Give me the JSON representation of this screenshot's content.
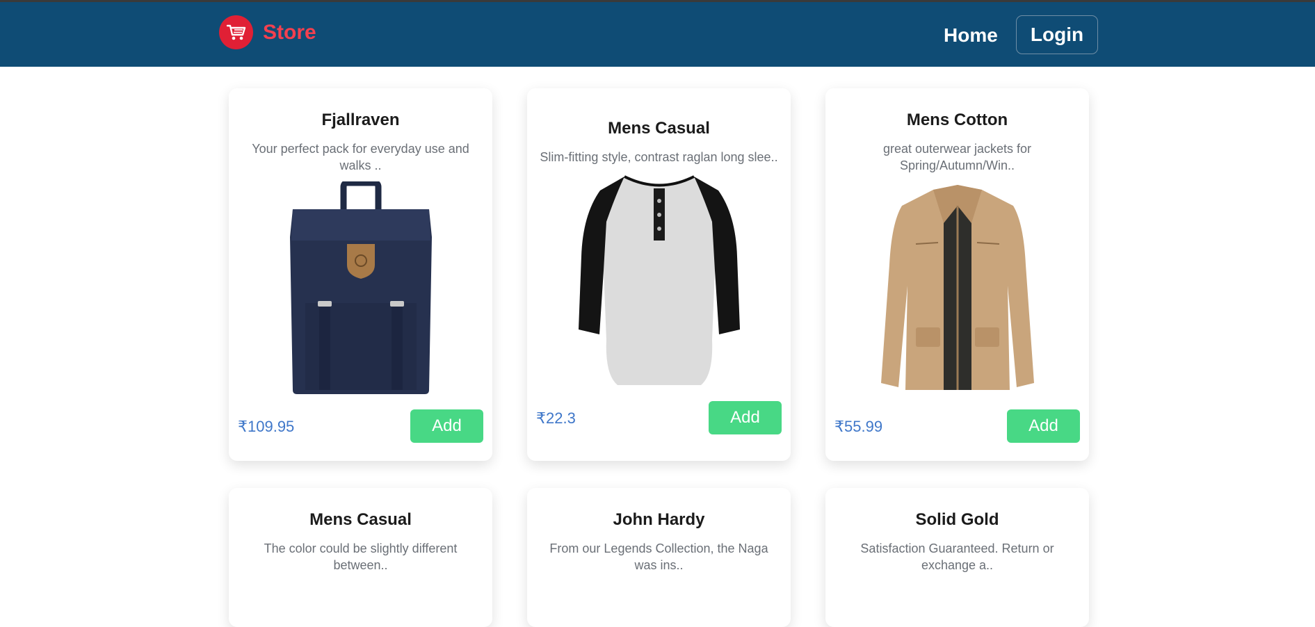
{
  "header": {
    "brand": "Store",
    "nav_home": "Home",
    "nav_login": "Login"
  },
  "colors": {
    "navbar": "#0f4c75",
    "brand": "#f4404f",
    "price": "#3f77c9",
    "add_button": "#48d885"
  },
  "products": [
    {
      "title": "Fjallraven",
      "description": "Your perfect pack for everyday use and walks ..",
      "price": "₹109.95",
      "add_label": "Add",
      "image_icon": "backpack-icon"
    },
    {
      "title": "Mens Casual",
      "description": "Slim-fitting style, contrast raglan long slee..",
      "price": "₹22.3",
      "add_label": "Add",
      "image_icon": "tshirt-icon"
    },
    {
      "title": "Mens Cotton",
      "description": "great outerwear jackets for Spring/Autumn/Win..",
      "price": "₹55.99",
      "add_label": "Add",
      "image_icon": "jacket-icon"
    },
    {
      "title": "Mens Casual",
      "description": "The color could be slightly different between..",
      "image_icon": ""
    },
    {
      "title": "John Hardy",
      "description": "From our Legends Collection, the Naga was ins..",
      "image_icon": ""
    },
    {
      "title": "Solid Gold",
      "description": "Satisfaction Guaranteed. Return or exchange a..",
      "image_icon": ""
    }
  ]
}
